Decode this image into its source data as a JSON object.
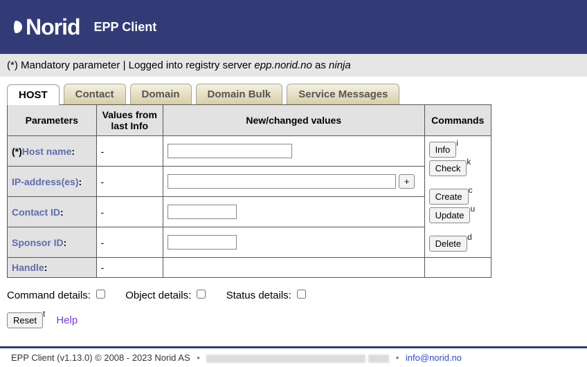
{
  "brand": "Norid",
  "app_title": "EPP Client",
  "status": {
    "mandatory_text": "(*) Mandatory parameter",
    "separator": " | ",
    "logged_text_prefix": "Logged into registry server ",
    "server": "epp.norid.no",
    "as_text": " as ",
    "user": "ninja"
  },
  "tabs": {
    "host": "HOST",
    "contact": "Contact",
    "domain": "Domain",
    "domain_bulk": "Domain Bulk",
    "service_messages": "Service Messages"
  },
  "headers": {
    "parameters": "Parameters",
    "last_info": "Values from last Info",
    "new_values": "New/changed values",
    "commands": "Commands"
  },
  "rows": {
    "hostname": {
      "star": "(*)",
      "label": "Host name",
      "colon": ":",
      "last": "-",
      "value": ""
    },
    "ip": {
      "label": "IP-address(es)",
      "colon": ":",
      "last": "-",
      "value": "",
      "plus": "+"
    },
    "contactid": {
      "label": "Contact ID",
      "colon": ":",
      "last": "-",
      "value": ""
    },
    "sponsorid": {
      "label": "Sponsor ID",
      "colon": ":",
      "last": "-",
      "value": ""
    },
    "handle": {
      "label": "Handle",
      "colon": ":",
      "last": "-"
    }
  },
  "commands": {
    "info": "Info",
    "info_k": "i",
    "check": "Check",
    "check_k": "k",
    "create": "Create",
    "create_k": "c",
    "update": "Update",
    "update_k": "u",
    "delete": "Delete",
    "delete_k": "d"
  },
  "options": {
    "command_details": "Command details:",
    "object_details": "Object details:",
    "status_details": "Status details:"
  },
  "reset_label": "Reset",
  "reset_k": "t",
  "help_label": "Help",
  "footer": {
    "text": "EPP Client (v1.13.0) © 2008 - 2023 Norid AS",
    "bullet": "•",
    "email": "info@norid.no"
  }
}
